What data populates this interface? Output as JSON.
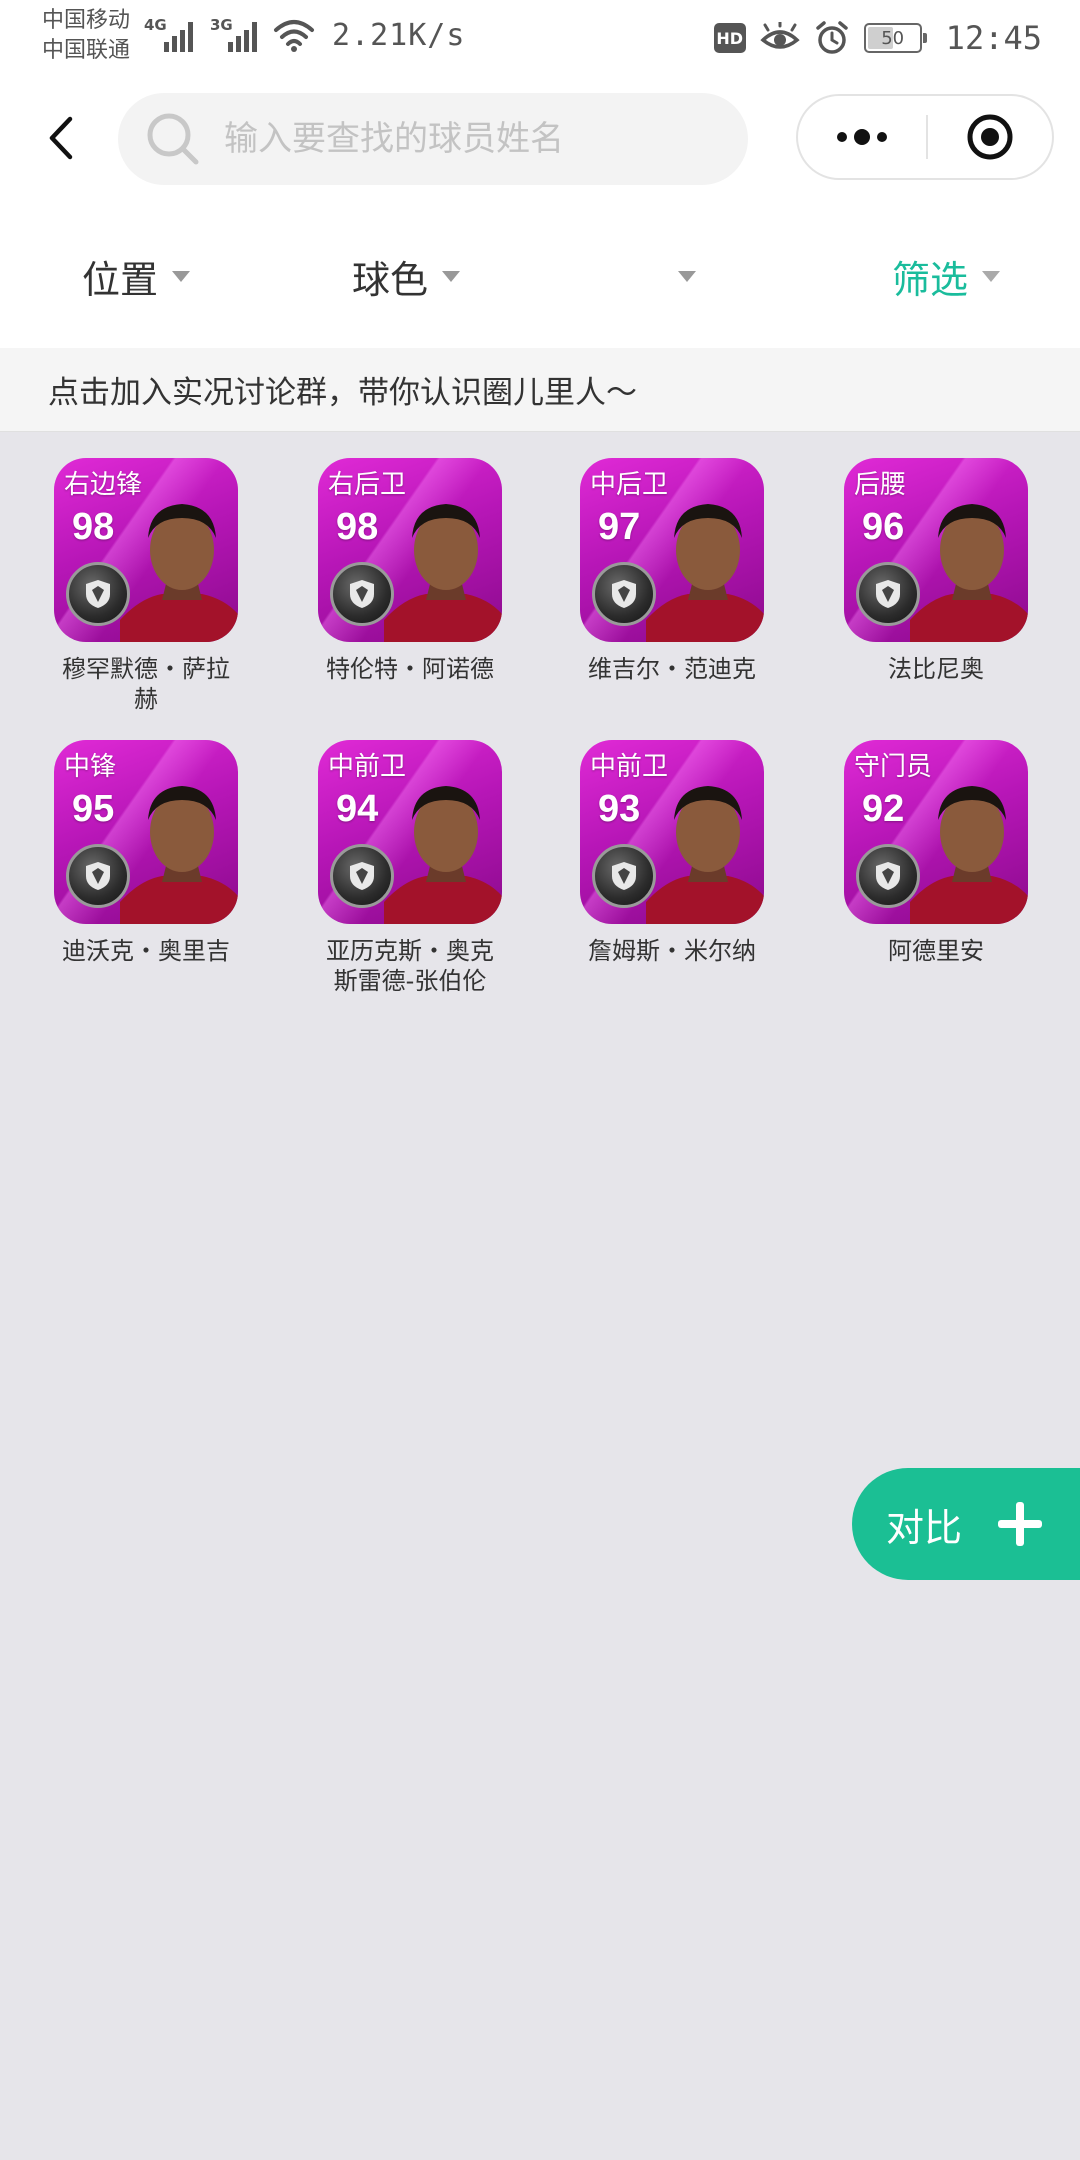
{
  "status_bar": {
    "carrier_1": "中国移动",
    "carrier_2": "中国联通",
    "network_1": "4G",
    "network_2": "3G",
    "speed": "2.21K/s",
    "hd": "HD",
    "battery": "50",
    "battery_level": 0.5,
    "time": "12:45",
    "icons": [
      "signal-icon",
      "wifi-icon",
      "eye-icon",
      "alarm-icon",
      "battery-icon"
    ]
  },
  "nav": {
    "back_icon": "chevron-left-icon",
    "search_placeholder": "输入要查找的球员姓名",
    "more_icon": "more-dots-icon",
    "close_icon": "target-icon"
  },
  "filters": [
    {
      "label": "位置",
      "active": false
    },
    {
      "label": "球色",
      "active": false
    },
    {
      "label": "",
      "active": false
    },
    {
      "label": "筛选",
      "active": true
    }
  ],
  "notice": {
    "text": "点击加入实况讨论群，带你认识圈儿里人～"
  },
  "players": [
    {
      "position": "右边锋",
      "rating": "98",
      "name": "穆罕默德・萨拉赫"
    },
    {
      "position": "右后卫",
      "rating": "98",
      "name": "特伦特・阿诺德"
    },
    {
      "position": "中后卫",
      "rating": "97",
      "name": "维吉尔・范迪克"
    },
    {
      "position": "后腰",
      "rating": "96",
      "name": "法比尼奥"
    },
    {
      "position": "中锋",
      "rating": "95",
      "name": "迪沃克・奥里吉"
    },
    {
      "position": "中前卫",
      "rating": "94",
      "name": "亚历克斯・奥克斯雷德-张伯伦"
    },
    {
      "position": "中前卫",
      "rating": "93",
      "name": "詹姆斯・米尔纳"
    },
    {
      "position": "守门员",
      "rating": "92",
      "name": "阿德里安"
    }
  ],
  "compare": {
    "label": "对比",
    "icon": "plus-icon"
  },
  "colors": {
    "accent": "#1abc9c",
    "card_purple": "#b716b7",
    "background": "#e6e5ea"
  }
}
